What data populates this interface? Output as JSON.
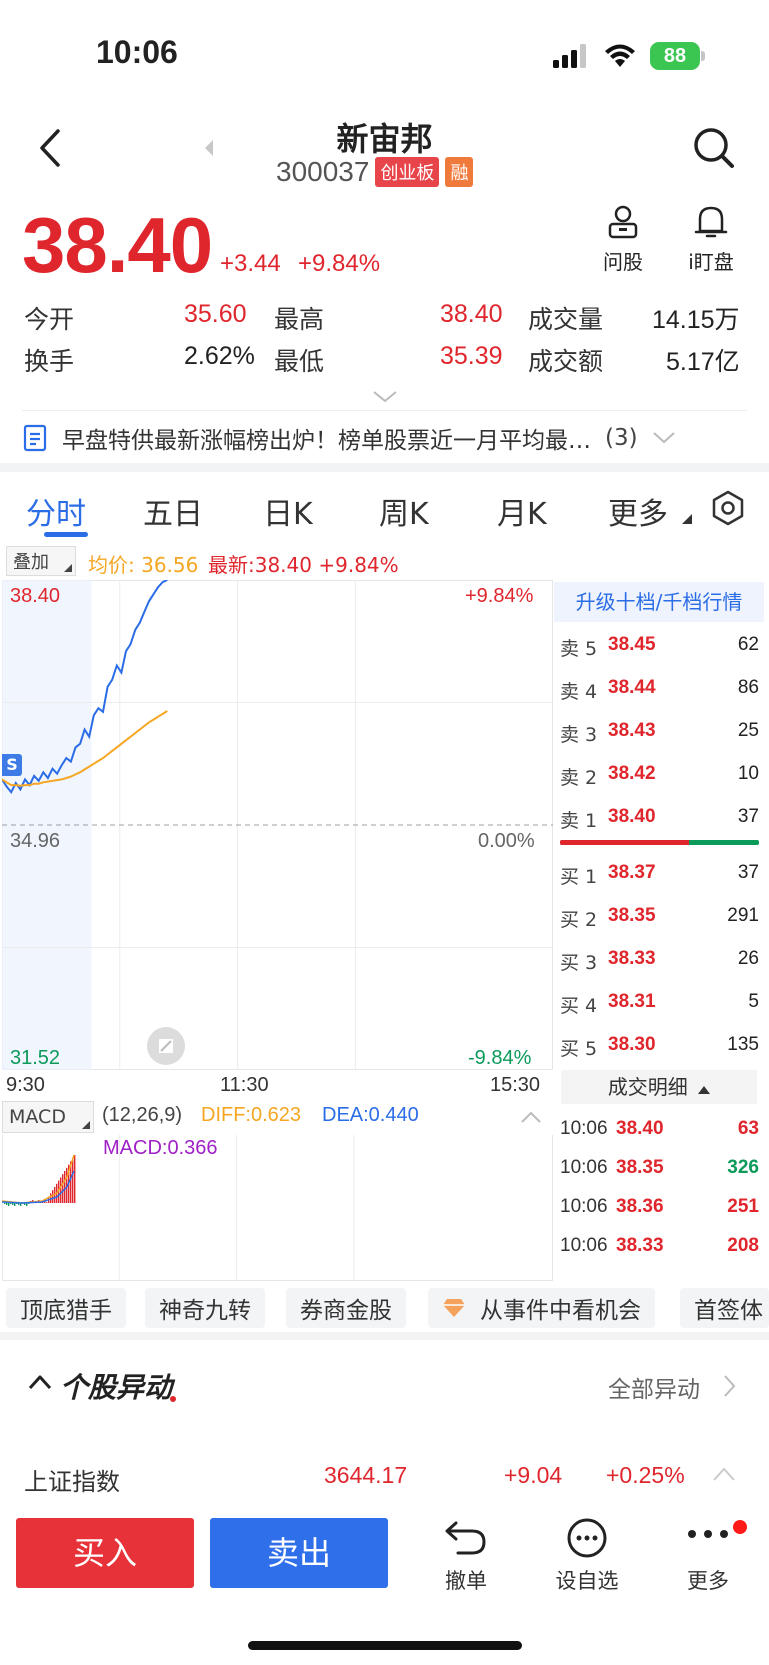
{
  "status_bar": {
    "time": "10:06",
    "battery": "88"
  },
  "header": {
    "stock_name": "新宙邦",
    "stock_code": "300037",
    "board_tag": "创业板",
    "margin_tag": "融",
    "ask_label": "问股",
    "watch_label": "i盯盘"
  },
  "quote": {
    "price": "38.40",
    "change": "+3.44",
    "change_pct": "+9.84%",
    "stats": [
      {
        "label": "今开",
        "value": "35.60"
      },
      {
        "label": "最高",
        "value": "38.40"
      },
      {
        "label": "成交量",
        "value": "14.15万"
      },
      {
        "label": "换手",
        "value": "2.62%"
      },
      {
        "label": "最低",
        "value": "35.39"
      },
      {
        "label": "成交额",
        "value": "5.17亿"
      }
    ]
  },
  "news": {
    "text": "早盘特供最新涨幅榜出炉！榜单股票近一月平均最…",
    "count": "(3)"
  },
  "tabs": [
    "分时",
    "五日",
    "日K",
    "周K",
    "月K",
    "更多"
  ],
  "chart_header": {
    "overlay_label": "叠加",
    "avg_label": "均价: 36.56",
    "latest_label": "最新:38.40 +9.84%"
  },
  "chart_data": {
    "type": "line",
    "x": [
      "9:30",
      "9:31",
      "9:32",
      "9:33",
      "9:34",
      "9:35",
      "9:36",
      "9:37",
      "9:38",
      "9:39",
      "9:40",
      "9:41",
      "9:42",
      "9:43",
      "9:44",
      "9:45",
      "9:46",
      "9:47",
      "9:48",
      "9:49",
      "9:50",
      "9:51",
      "9:52",
      "9:53",
      "9:54",
      "9:55",
      "9:56",
      "9:57",
      "9:58",
      "9:59",
      "10:00",
      "10:01",
      "10:02",
      "10:03",
      "10:04",
      "10:05",
      "10:06"
    ],
    "series": [
      {
        "values": [
          35.6,
          35.5,
          35.42,
          35.55,
          35.46,
          35.6,
          35.52,
          35.65,
          35.58,
          35.7,
          35.62,
          35.75,
          35.68,
          35.8,
          35.9,
          35.85,
          36.05,
          36.1,
          36.3,
          36.2,
          36.5,
          36.6,
          36.55,
          36.9,
          37.0,
          37.2,
          37.1,
          37.4,
          37.5,
          37.7,
          37.8,
          37.95,
          38.1,
          38.2,
          38.3,
          38.37,
          38.4
        ]
      },
      {
        "values": [
          35.6,
          35.56,
          35.52,
          35.52,
          35.51,
          35.52,
          35.52,
          35.54,
          35.54,
          35.56,
          35.57,
          35.58,
          35.59,
          35.6,
          35.62,
          35.64,
          35.67,
          35.7,
          35.74,
          35.78,
          35.82,
          35.86,
          35.9,
          35.95,
          36.0,
          36.05,
          36.1,
          36.15,
          36.2,
          36.25,
          36.3,
          36.35,
          36.4,
          36.44,
          36.48,
          36.52,
          36.56
        ]
      }
    ],
    "ylim": [
      31.52,
      38.4
    ],
    "y_ticks_left": [
      "38.40",
      "34.96",
      "31.52"
    ],
    "y_ticks_right": [
      "+9.84%",
      "0.00%",
      "-9.84%"
    ],
    "x_ticks": [
      "9:30",
      "11:30",
      "15:30"
    ],
    "grid": true
  },
  "orderbook": {
    "upgrade_label": "升级十档/千档行情",
    "asks": [
      {
        "label": "卖 5",
        "price": "38.45",
        "vol": "62"
      },
      {
        "label": "卖 4",
        "price": "38.44",
        "vol": "86"
      },
      {
        "label": "卖 3",
        "price": "38.43",
        "vol": "25"
      },
      {
        "label": "卖 2",
        "price": "38.42",
        "vol": "10"
      },
      {
        "label": "卖 1",
        "price": "38.40",
        "vol": "37"
      }
    ],
    "bids": [
      {
        "label": "买 1",
        "price": "38.37",
        "vol": "37"
      },
      {
        "label": "买 2",
        "price": "38.35",
        "vol": "291"
      },
      {
        "label": "买 3",
        "price": "38.33",
        "vol": "26"
      },
      {
        "label": "买 4",
        "price": "38.31",
        "vol": "5"
      },
      {
        "label": "买 5",
        "price": "38.30",
        "vol": "135"
      }
    ],
    "detail_label": "成交明细",
    "trades": [
      {
        "time": "10:06",
        "price": "38.40",
        "vol": "63"
      },
      {
        "time": "10:06",
        "price": "38.35",
        "vol": "326"
      },
      {
        "time": "10:06",
        "price": "38.36",
        "vol": "251"
      },
      {
        "time": "10:06",
        "price": "38.33",
        "vol": "208"
      }
    ]
  },
  "macd": {
    "label": "MACD",
    "params": "(12,26,9)",
    "diff": "DIFF:0.623",
    "dea": "DEA:0.440",
    "value": "MACD:0.366"
  },
  "chips": [
    "顶底猎手",
    "神奇九转",
    "券商金股",
    "从事件中看机会",
    "首签体"
  ],
  "anomaly": {
    "title": "个股异动",
    "all_label": "全部异动",
    "index_name": "上证指数",
    "index_value": "3644.17",
    "index_change": "+9.04",
    "index_pct": "+0.25%"
  },
  "bottom_bar": {
    "buy": "买入",
    "sell": "卖出",
    "cancel": "撤单",
    "watchlist": "设自选",
    "more": "更多"
  },
  "colors": {
    "up": "#e0262d",
    "down": "#0c9a5a",
    "accent": "#2b6de6",
    "avg": "#f5a623"
  }
}
